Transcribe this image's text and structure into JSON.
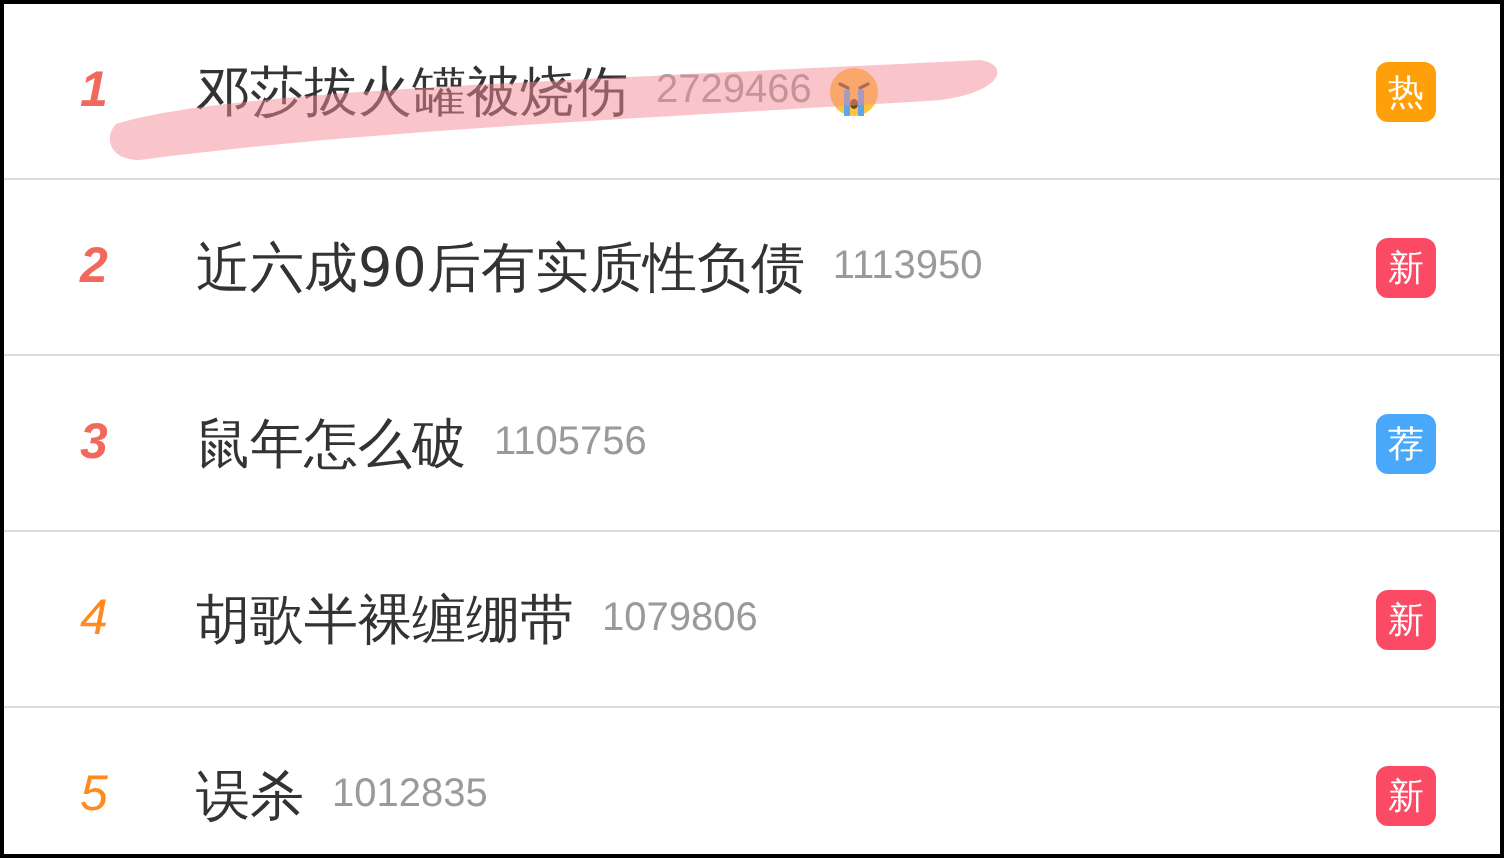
{
  "hot_list": [
    {
      "rank": "1",
      "top": true,
      "title": "邓莎拔火罐被烧伤",
      "count": "2729466",
      "emoji": true,
      "highlighted": true,
      "badge": {
        "label": "热",
        "color": "#ffa00a"
      }
    },
    {
      "rank": "2",
      "top": true,
      "title": "近六成90后有实质性负债",
      "count": "1113950",
      "emoji": false,
      "highlighted": false,
      "badge": {
        "label": "新",
        "color": "#fb4b64"
      }
    },
    {
      "rank": "3",
      "top": true,
      "title": "鼠年怎么破",
      "count": "1105756",
      "emoji": false,
      "highlighted": false,
      "badge": {
        "label": "荐",
        "color": "#4aa8fb"
      }
    },
    {
      "rank": "4",
      "top": false,
      "title": "胡歌半裸缠绷带",
      "count": "1079806",
      "emoji": false,
      "highlighted": false,
      "badge": {
        "label": "新",
        "color": "#fb4b64"
      }
    },
    {
      "rank": "5",
      "top": false,
      "title": "误杀",
      "count": "1012835",
      "emoji": false,
      "highlighted": false,
      "badge": {
        "label": "新",
        "color": "#fb4b64"
      }
    }
  ]
}
